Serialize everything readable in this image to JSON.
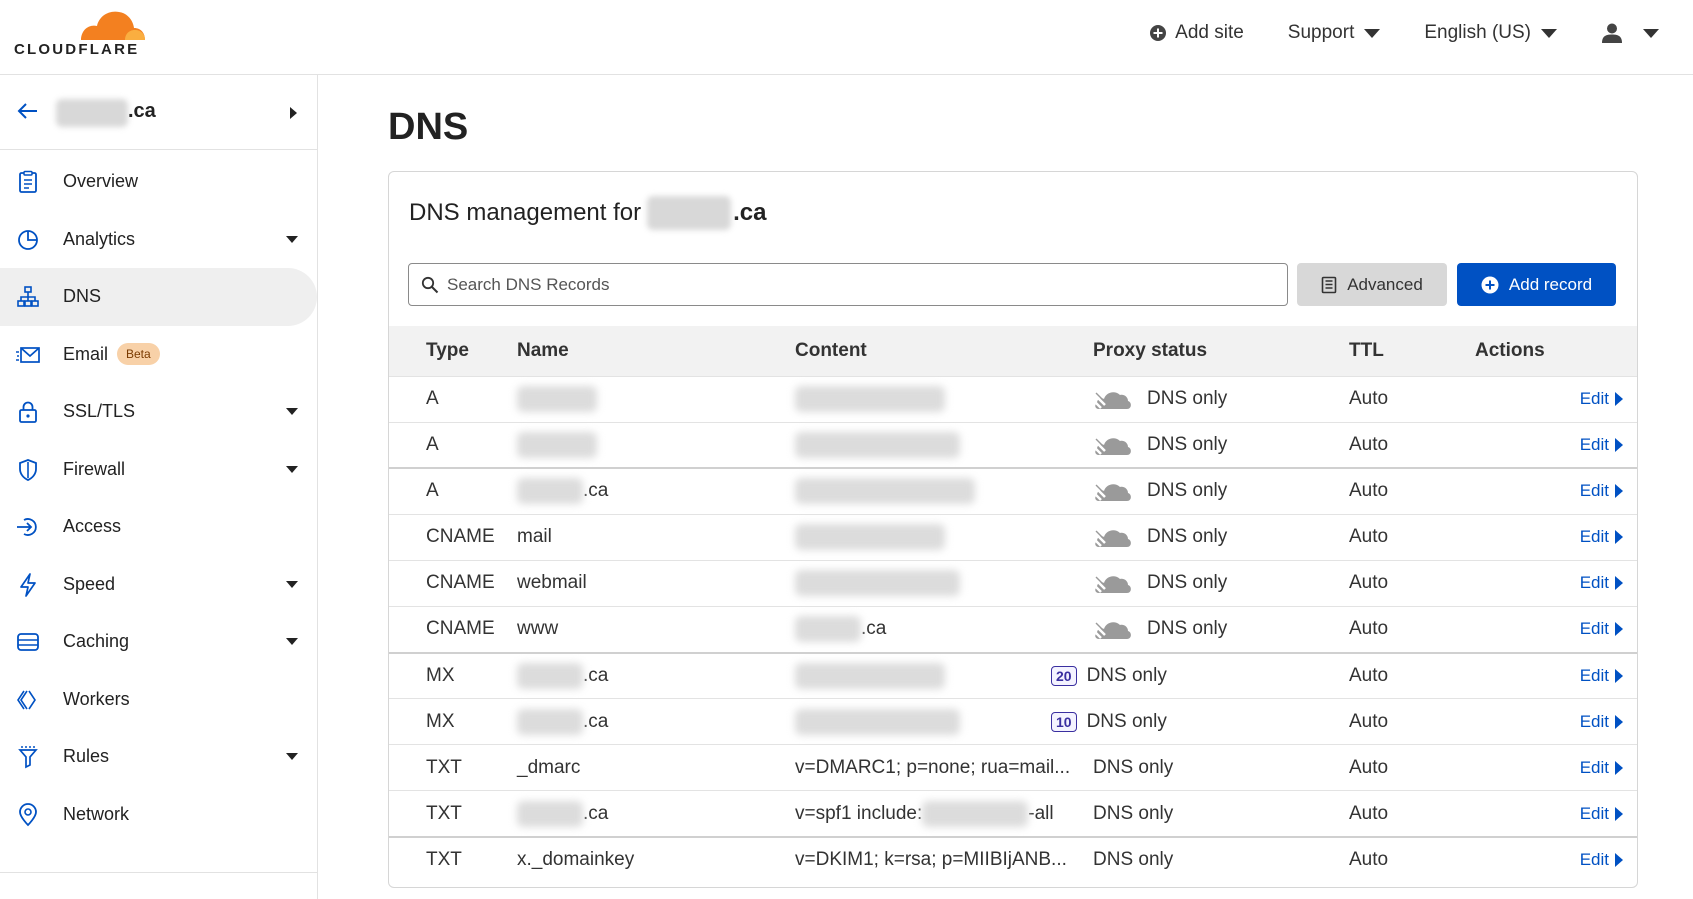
{
  "brand": {
    "logo_text": "CLOUDFLARE",
    "accent": "#f38020",
    "link_color": "#0051c3"
  },
  "topnav": {
    "add_site": "Add site",
    "support": "Support",
    "language": "English (US)"
  },
  "sidebar": {
    "zone_tld": ".ca",
    "items": [
      {
        "label": "Overview",
        "icon": "clipboard-icon",
        "dropdown": false
      },
      {
        "label": "Analytics",
        "icon": "pie-chart-icon",
        "dropdown": true
      },
      {
        "label": "DNS",
        "icon": "network-tree-icon",
        "dropdown": false,
        "active": true
      },
      {
        "label": "Email",
        "icon": "envelope-icon",
        "dropdown": false,
        "badge": "Beta"
      },
      {
        "label": "SSL/TLS",
        "icon": "lock-icon",
        "dropdown": true
      },
      {
        "label": "Firewall",
        "icon": "shield-icon",
        "dropdown": true
      },
      {
        "label": "Access",
        "icon": "access-arrow-icon",
        "dropdown": false
      },
      {
        "label": "Speed",
        "icon": "lightning-icon",
        "dropdown": true
      },
      {
        "label": "Caching",
        "icon": "server-stack-icon",
        "dropdown": true
      },
      {
        "label": "Workers",
        "icon": "workers-icon",
        "dropdown": false
      },
      {
        "label": "Rules",
        "icon": "filter-funnel-icon",
        "dropdown": true
      },
      {
        "label": "Network",
        "icon": "location-pin-icon",
        "dropdown": false
      }
    ]
  },
  "main": {
    "title": "DNS",
    "card_title_prefix": "DNS management for",
    "card_title_tld": ".ca",
    "search_placeholder": "Search DNS Records",
    "advanced_label": "Advanced",
    "add_record_label": "Add record",
    "table": {
      "headers": {
        "type": "Type",
        "name": "Name",
        "content": "Content",
        "proxy": "Proxy status",
        "ttl": "TTL",
        "actions": "Actions"
      },
      "rows": [
        {
          "type": "A",
          "name": "",
          "content": "",
          "proxy": "DNS only",
          "ttl": "Auto",
          "edit": "Edit"
        },
        {
          "type": "A",
          "name": "",
          "content": "",
          "proxy": "DNS only",
          "ttl": "Auto",
          "edit": "Edit"
        },
        {
          "type": "A",
          "name": ".ca",
          "content": "",
          "proxy": "DNS only",
          "ttl": "Auto",
          "edit": "Edit"
        },
        {
          "type": "CNAME",
          "name": "mail",
          "content": "",
          "proxy": "DNS only",
          "ttl": "Auto",
          "edit": "Edit"
        },
        {
          "type": "CNAME",
          "name": "webmail",
          "content": "",
          "proxy": "DNS only",
          "ttl": "Auto",
          "edit": "Edit"
        },
        {
          "type": "CNAME",
          "name": "www",
          "content": ".ca",
          "proxy": "DNS only",
          "ttl": "Auto",
          "edit": "Edit"
        },
        {
          "type": "MX",
          "name": ".ca",
          "content": "",
          "priority": "20",
          "proxy": "DNS only",
          "ttl": "Auto",
          "edit": "Edit"
        },
        {
          "type": "MX",
          "name": ".ca",
          "content": "",
          "priority": "10",
          "proxy": "DNS only",
          "ttl": "Auto",
          "edit": "Edit"
        },
        {
          "type": "TXT",
          "name": "_dmarc",
          "content": "v=DMARC1; p=none; rua=mail...",
          "proxy": "DNS only",
          "ttl": "Auto",
          "edit": "Edit"
        },
        {
          "type": "TXT",
          "name": ".ca",
          "content_prefix": "v=spf1 include:",
          "content_suffix": "-all",
          "proxy": "DNS only",
          "ttl": "Auto",
          "edit": "Edit"
        },
        {
          "type": "TXT",
          "name": "x._domainkey",
          "content": "v=DKIM1; k=rsa; p=MIIBIjANB...",
          "proxy": "DNS only",
          "ttl": "Auto",
          "edit": "Edit"
        }
      ]
    }
  }
}
